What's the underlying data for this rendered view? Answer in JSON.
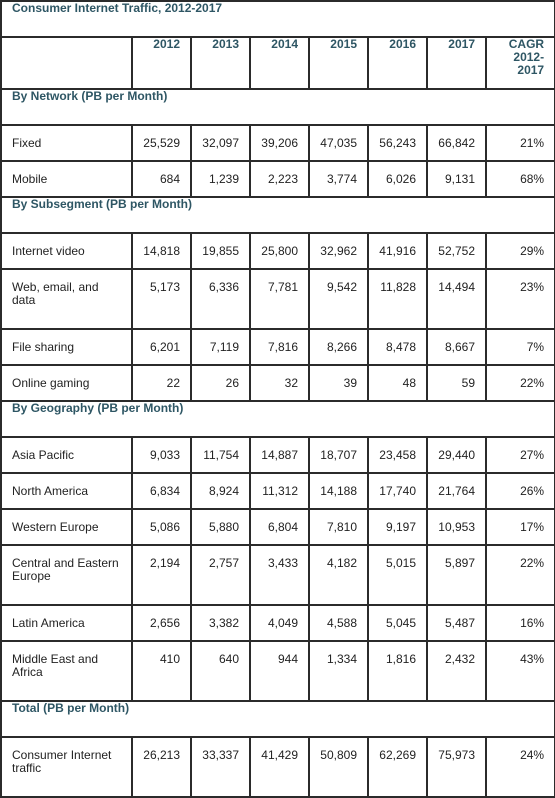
{
  "title": "Consumer Internet Traffic, 2012-2017",
  "header": {
    "blank": "",
    "years": [
      "2012",
      "2013",
      "2014",
      "2015",
      "2016",
      "2017"
    ],
    "cagr_lines": [
      "CAGR",
      "2012-",
      "2017"
    ]
  },
  "sections": [
    {
      "heading": "By Network (PB per Month)",
      "rows": [
        {
          "label": "Fixed",
          "values": [
            "25,529",
            "32,097",
            "39,206",
            "47,035",
            "56,243",
            "66,842"
          ],
          "cagr": "21%"
        },
        {
          "label": "Mobile",
          "values": [
            "684",
            "1,239",
            "2,223",
            "3,774",
            "6,026",
            "9,131"
          ],
          "cagr": "68%"
        }
      ]
    },
    {
      "heading": "By Subsegment (PB per Month)",
      "rows": [
        {
          "label": "Internet video",
          "values": [
            "14,818",
            "19,855",
            "25,800",
            "32,962",
            "41,916",
            "52,752"
          ],
          "cagr": "29%"
        },
        {
          "label": "Web, email, and data",
          "values": [
            "5,173",
            "6,336",
            "7,781",
            "9,542",
            "11,828",
            "14,494"
          ],
          "cagr": "23%"
        },
        {
          "label": "File sharing",
          "values": [
            "6,201",
            "7,119",
            "7,816",
            "8,266",
            "8,478",
            "8,667"
          ],
          "cagr": "7%"
        },
        {
          "label": "Online gaming",
          "values": [
            "22",
            "26",
            "32",
            "39",
            "48",
            "59"
          ],
          "cagr": "22%"
        }
      ]
    },
    {
      "heading": "By Geography (PB per Month)",
      "rows": [
        {
          "label": "Asia Pacific",
          "values": [
            "9,033",
            "11,754",
            "14,887",
            "18,707",
            "23,458",
            "29,440"
          ],
          "cagr": "27%"
        },
        {
          "label": "North America",
          "values": [
            "6,834",
            "8,924",
            "11,312",
            "14,188",
            "17,740",
            "21,764"
          ],
          "cagr": "26%"
        },
        {
          "label": "Western Europe",
          "values": [
            "5,086",
            "5,880",
            "6,804",
            "7,810",
            "9,197",
            "10,953"
          ],
          "cagr": "17%"
        },
        {
          "label": "Central and Eastern Europe",
          "values": [
            "2,194",
            "2,757",
            "3,433",
            "4,182",
            "5,015",
            "5,897"
          ],
          "cagr": "22%"
        },
        {
          "label": "Latin America",
          "values": [
            "2,656",
            "3,382",
            "4,049",
            "4,588",
            "5,045",
            "5,487"
          ],
          "cagr": "16%"
        },
        {
          "label": "Middle East and Africa",
          "values": [
            "410",
            "640",
            "944",
            "1,334",
            "1,816",
            "2,432"
          ],
          "cagr": "43%"
        }
      ]
    },
    {
      "heading": "Total (PB per Month)",
      "rows": [
        {
          "label": "Consumer Internet traffic",
          "values": [
            "26,213",
            "33,337",
            "41,429",
            "50,809",
            "62,269",
            "75,973"
          ],
          "cagr": "24%"
        }
      ]
    }
  ]
}
